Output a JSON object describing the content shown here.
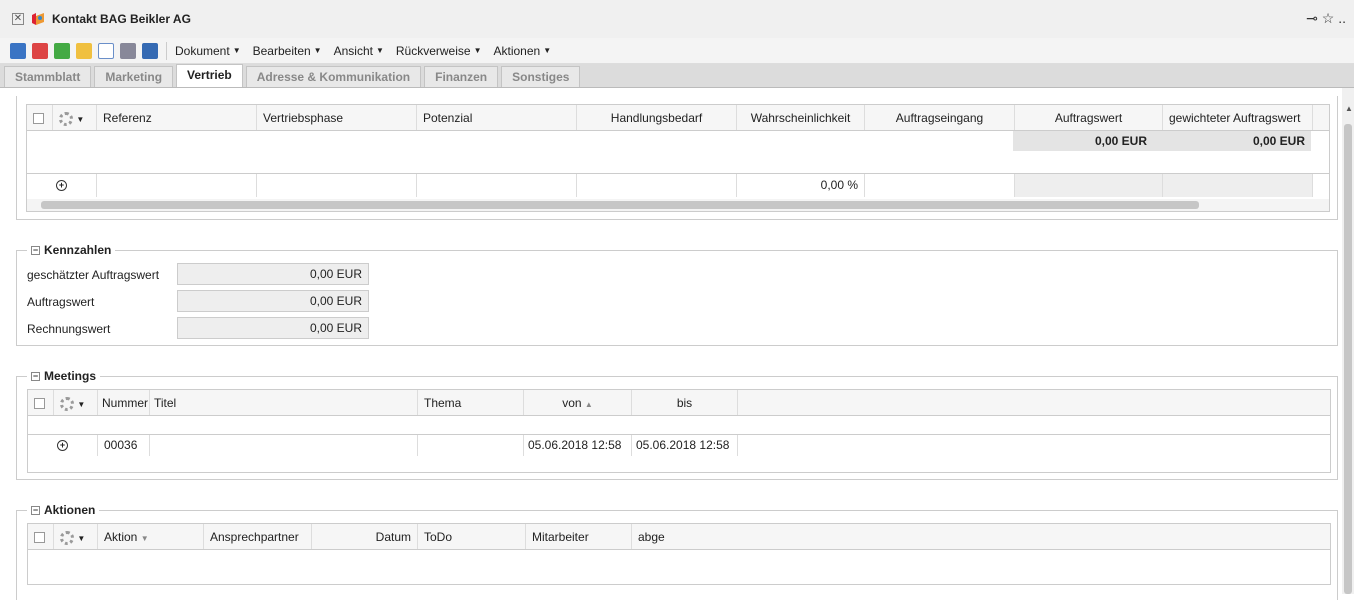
{
  "window": {
    "title": "Kontakt BAG Beikler AG",
    "close": "✕",
    "right_icons": "⊸ ☆ .."
  },
  "toolbar": {
    "menus": [
      "Dokument",
      "Bearbeiten",
      "Ansicht",
      "Rückverweise",
      "Aktionen"
    ]
  },
  "tabs": [
    "Stammblatt",
    "Marketing",
    "Vertrieb",
    "Adresse & Kommunikation",
    "Finanzen",
    "Sonstiges"
  ],
  "sales_grid": {
    "columns": [
      "Referenz",
      "Vertriebsphase",
      "Potenzial",
      "Handlungsbedarf",
      "Wahrscheinlichkeit",
      "Auftragseingang",
      "Auftragswert",
      "gewichteter Auftragswert"
    ],
    "sum_auftragswert": "0,00 EUR",
    "sum_gewichtet": "0,00 EUR",
    "new_row_wahrscheinlichkeit": "0,00 %"
  },
  "kennzahlen": {
    "title": "Kennzahlen",
    "rows": [
      {
        "label": "geschätzter Auftragswert",
        "value": "0,00 EUR"
      },
      {
        "label": "Auftragswert",
        "value": "0,00 EUR"
      },
      {
        "label": "Rechnungswert",
        "value": "0,00 EUR"
      }
    ]
  },
  "meetings": {
    "title": "Meetings",
    "columns": [
      "Nummer",
      "Titel",
      "Thema",
      "von",
      "bis"
    ],
    "sort_arrow": "▲",
    "row": {
      "nummer": "00036",
      "titel": "",
      "thema": "",
      "von": "05.06.2018 12:58",
      "bis": "05.06.2018 12:58"
    }
  },
  "aktionen": {
    "title": "Aktionen",
    "columns": [
      "Aktion",
      "Ansprechpartner",
      "Datum",
      "ToDo",
      "Mitarbeiter",
      "abge"
    ],
    "sort_arrow": "▼"
  }
}
